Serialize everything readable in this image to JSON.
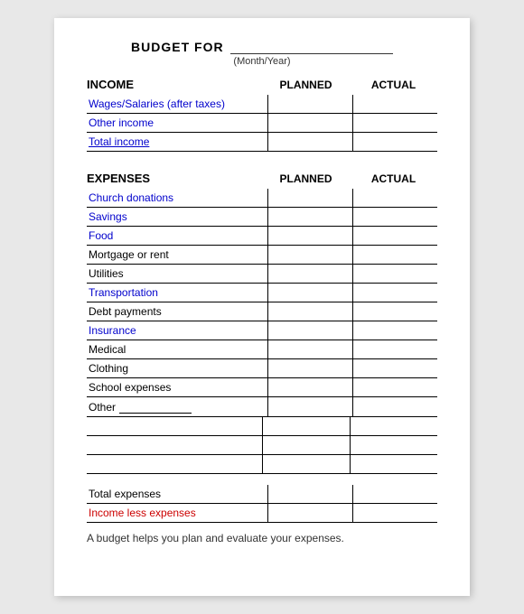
{
  "title": {
    "budget_for": "BUDGET FOR",
    "month_year_label": "(Month/Year)"
  },
  "income_section": {
    "label": "INCOME",
    "planned_header": "PLANNED",
    "actual_header": "ACTUAL",
    "rows": [
      {
        "label": "Wages/Salaries (after taxes)",
        "blue": true
      },
      {
        "label": "Other income",
        "blue": true
      },
      {
        "label": "Total income",
        "blue": true,
        "underline": true
      }
    ]
  },
  "expenses_section": {
    "label": "EXPENSES",
    "planned_header": "PLANNED",
    "actual_header": "ACTUAL",
    "rows": [
      {
        "label": "Church donations",
        "blue": true
      },
      {
        "label": "Savings",
        "blue": true
      },
      {
        "label": "Food",
        "blue": true
      },
      {
        "label": "Mortgage or rent",
        "blue": false
      },
      {
        "label": "Utilities",
        "blue": false
      },
      {
        "label": "Transportation",
        "blue": true
      },
      {
        "label": "Debt payments",
        "blue": false
      },
      {
        "label": "Insurance",
        "blue": true
      },
      {
        "label": "Medical",
        "blue": false
      },
      {
        "label": "Clothing",
        "blue": false
      },
      {
        "label": "School expenses",
        "blue": false
      },
      {
        "label": "Other",
        "blue": false,
        "underline_text": true
      }
    ],
    "blank_rows": 3,
    "total_rows": [
      {
        "label": "Total expenses",
        "blue": false
      },
      {
        "label": "Income less expenses",
        "red": true
      }
    ]
  },
  "footer": {
    "text": "A budget helps you plan and evaluate your expenses."
  }
}
